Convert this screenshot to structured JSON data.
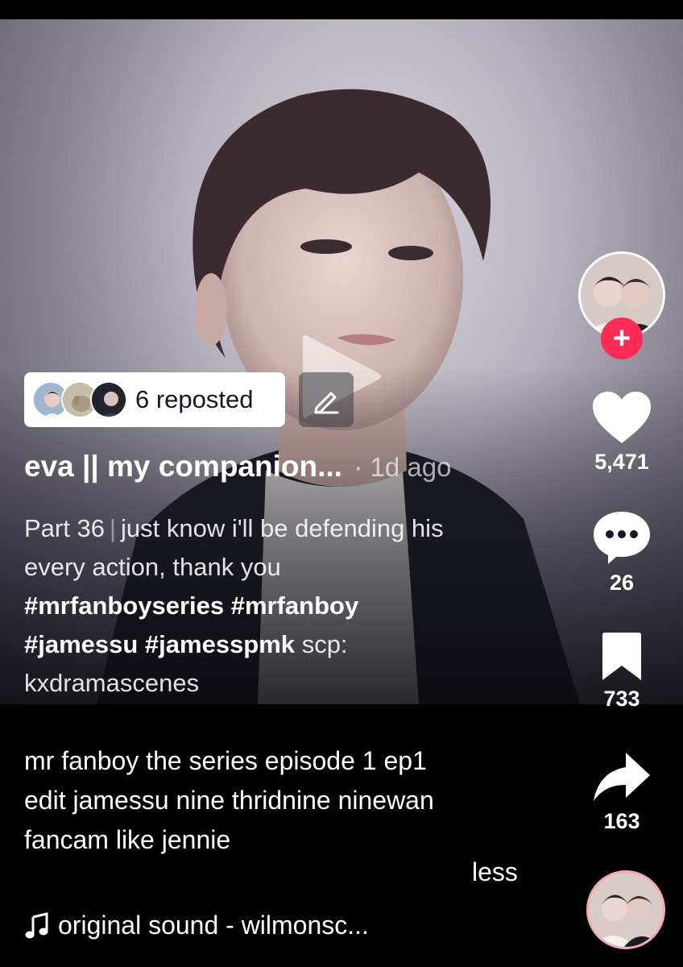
{
  "video": {
    "repost": {
      "label": "6 reposted"
    },
    "author": {
      "username": "eva || my companion...",
      "time": "· 1d ago"
    },
    "description": {
      "part": "Part 36",
      "separator": "|",
      "text_line1": "just know i'll be defending his",
      "text_line2": "every action, thank you",
      "hashtags_line1": "#mrfanboyseries #mrfanboy",
      "hashtags_line2": "#jamessu #jamesspmk",
      "scp_label": "scp:",
      "scp_handle": "kxdramascenes"
    },
    "search_description": {
      "line1": "mr fanboy the series episode 1 ep1",
      "line2": "edit jamessu  nine thridnine ninewan",
      "line3": "fancam like jennie"
    },
    "less_label": "less",
    "sound": {
      "note_icon": "music-note-icon",
      "label": "original sound - wilmonsc..."
    }
  },
  "actions": {
    "follow_symbol": "+",
    "likes": "5,471",
    "comments": "26",
    "saves": "733",
    "shares": "163"
  },
  "colors": {
    "follow": "#fe2c55",
    "text": "#ffffff",
    "chip_text": "#161823"
  }
}
